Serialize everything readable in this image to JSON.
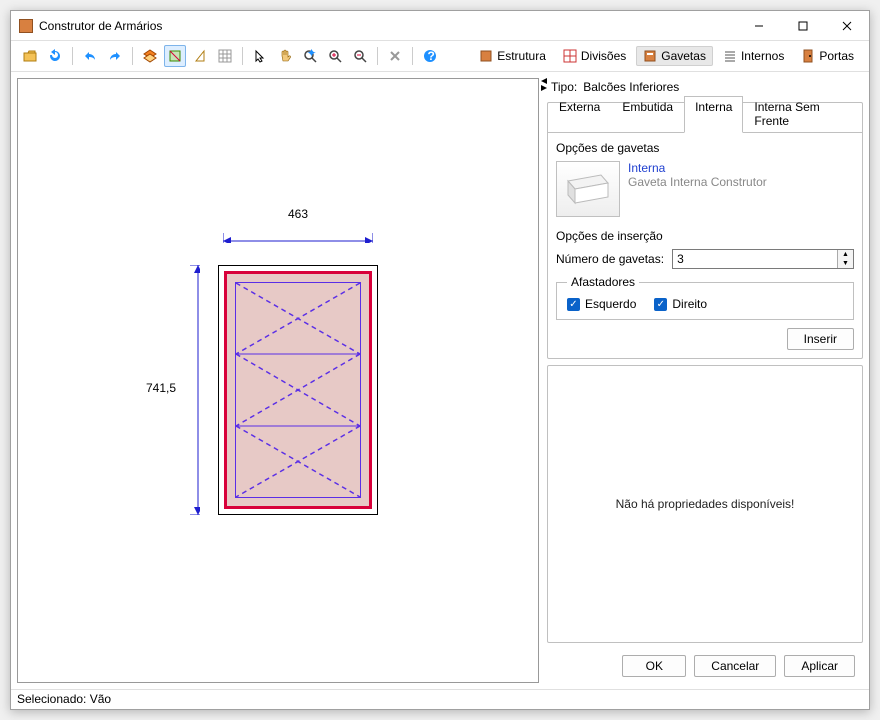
{
  "window": {
    "title": "Construtor de Armários"
  },
  "toolbar_icons": {
    "open": "open",
    "new": "new",
    "undo": "undo",
    "redo": "redo",
    "layers": "layers",
    "select-box": "select-box",
    "triangle": "triangle",
    "grid": "grid",
    "arrow-ne": "arrow",
    "hand": "hand",
    "zoom-fit": "zoom-fit",
    "zoom-in": "zoom-in",
    "zoom-out": "zoom-out",
    "delete": "delete",
    "help": "help"
  },
  "right_tabs": {
    "estrutura": "Estrutura",
    "divisoes": "Divisões",
    "gavetas": "Gavetas",
    "internos": "Internos",
    "portas": "Portas"
  },
  "tipo": {
    "label": "Tipo:",
    "value": "Balcões Inferiores"
  },
  "drawer_tabs": {
    "externa": "Externa",
    "embutida": "Embutida",
    "interna": "Interna",
    "interna_sem_frente": "Interna Sem Frente"
  },
  "options": {
    "gavetas_title": "Opções de gavetas",
    "thumb_title": "Interna",
    "thumb_sub": "Gaveta Interna Construtor",
    "insercao_title": "Opções de inserção",
    "numero_label": "Número de gavetas:",
    "numero_value": "3",
    "afastadores": "Afastadores",
    "esquerdo": "Esquerdo",
    "direito": "Direito",
    "inserir": "Inserir"
  },
  "dims": {
    "width": "463",
    "height": "741,5"
  },
  "props": {
    "empty": "Não há propriedades disponíveis!"
  },
  "footer": {
    "ok": "OK",
    "cancel": "Cancelar",
    "apply": "Aplicar"
  },
  "status": {
    "text": "Selecionado: Vão"
  }
}
